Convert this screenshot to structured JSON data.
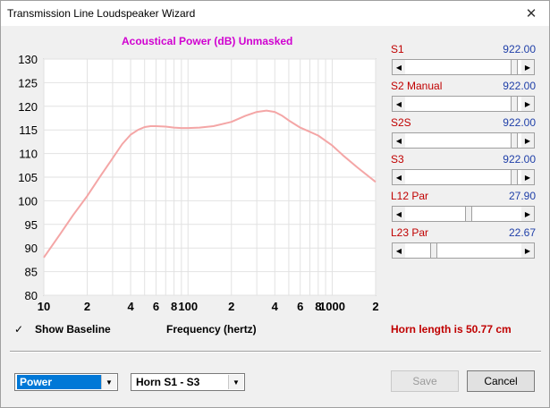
{
  "window": {
    "title": "Transmission Line Loudspeaker Wizard",
    "close_glyph": "✕"
  },
  "chart_title": "Acoustical Power (dB)   Unmasked",
  "chart_data": {
    "type": "line",
    "title": "Acoustical Power (dB)   Unmasked",
    "xlabel": "Frequency (hertz)",
    "ylabel": "",
    "x_scale": "log",
    "xlim": [
      10,
      2000
    ],
    "ylim": [
      80,
      130
    ],
    "y_ticks": [
      80,
      85,
      90,
      95,
      100,
      105,
      110,
      115,
      120,
      125,
      130
    ],
    "x_ticks": [
      {
        "value": 10,
        "label": "10"
      },
      {
        "value": 20,
        "label": "2"
      },
      {
        "value": 40,
        "label": "4"
      },
      {
        "value": 60,
        "label": "6"
      },
      {
        "value": 80,
        "label": "8"
      },
      {
        "value": 100,
        "label": "100"
      },
      {
        "value": 200,
        "label": "2"
      },
      {
        "value": 400,
        "label": "4"
      },
      {
        "value": 600,
        "label": "6"
      },
      {
        "value": 800,
        "label": "8"
      },
      {
        "value": 1000,
        "label": "1000"
      },
      {
        "value": 2000,
        "label": "2"
      }
    ],
    "grid": true,
    "line_color": "#f4a6a6",
    "series": [
      {
        "x": [
          10,
          13,
          16,
          20,
          25,
          30,
          35,
          40,
          45,
          50,
          55,
          60,
          70,
          80,
          90,
          100,
          120,
          150,
          200,
          250,
          300,
          350,
          400,
          450,
          500,
          600,
          700,
          800,
          1000,
          1200,
          1500,
          2000
        ],
        "values": [
          88,
          93,
          97,
          101,
          105.5,
          109,
          112,
          114,
          115,
          115.6,
          115.8,
          115.8,
          115.7,
          115.5,
          115.4,
          115.4,
          115.5,
          115.8,
          116.7,
          118,
          118.8,
          119.1,
          118.8,
          118,
          117,
          115.5,
          114.6,
          113.8,
          111.7,
          109.5,
          107,
          104
        ]
      }
    ]
  },
  "sliders": [
    {
      "label": "S1",
      "value": "922.00",
      "level": 0.97
    },
    {
      "label": "S2  Manual",
      "value": "922.00",
      "level": 0.97
    },
    {
      "label": "S2S",
      "value": "922.00",
      "level": 0.97
    },
    {
      "label": "S3",
      "value": "922.00",
      "level": 0.97
    },
    {
      "label": "L12  Par",
      "value": "27.90",
      "level": 0.55
    },
    {
      "label": "L23  Par",
      "value": "22.67",
      "level": 0.23
    }
  ],
  "show_baseline": {
    "label": "Show Baseline",
    "checked": true,
    "check_glyph": "✓"
  },
  "frequency_label": "Frequency (hertz)",
  "horn_length": "Horn length is 50.77 cm",
  "combo_mode": {
    "value": "Power"
  },
  "combo_section": {
    "value": "Horn S1 - S3"
  },
  "buttons": {
    "save": "Save",
    "cancel": "Cancel"
  },
  "icons": {
    "arrow_left": "◀",
    "arrow_right": "▶",
    "arrow_down": "▼"
  }
}
